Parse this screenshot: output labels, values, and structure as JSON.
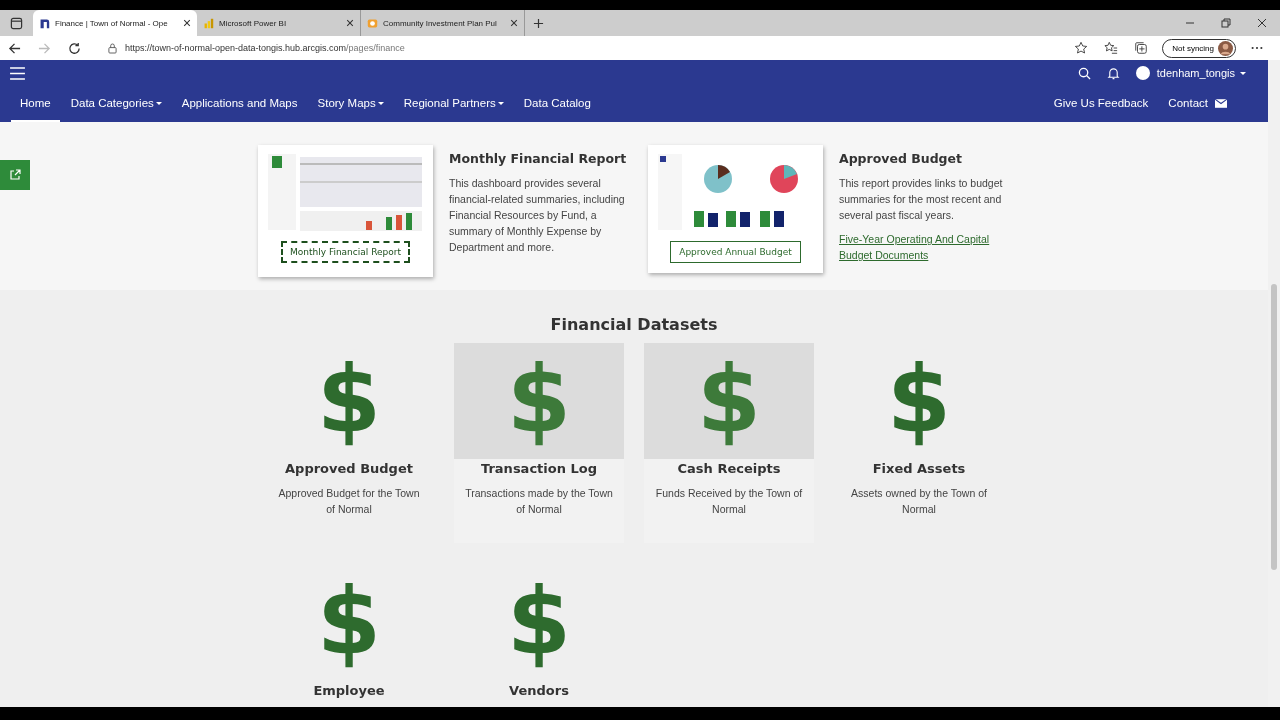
{
  "browser": {
    "tabs": [
      {
        "title": "Finance | Town of Normal - Ope",
        "selected": true
      },
      {
        "title": "Microsoft Power BI",
        "selected": false
      },
      {
        "title": "Community Investment Plan Pul",
        "selected": false
      }
    ],
    "url_host": "https://town-of-normal-open-data-tongis.hub.arcgis.com",
    "url_path": "/pages/finance",
    "sync": "Not syncing"
  },
  "header": {
    "user": "tdenham_tongis",
    "nav": [
      {
        "label": "Home",
        "selected": true,
        "dropdown": false
      },
      {
        "label": "Data Categories",
        "selected": false,
        "dropdown": true
      },
      {
        "label": "Applications and Maps",
        "selected": false,
        "dropdown": false
      },
      {
        "label": "Story Maps",
        "selected": false,
        "dropdown": true
      },
      {
        "label": "Regional Partners",
        "selected": false,
        "dropdown": true
      },
      {
        "label": "Data Catalog",
        "selected": false,
        "dropdown": false
      }
    ],
    "right_links": [
      {
        "label": "Give Us Feedback",
        "kind": "link"
      },
      {
        "label": "Contact",
        "kind": "contact"
      }
    ]
  },
  "featured": [
    {
      "title": "Monthly Financial Report",
      "description": "This dashboard provides several financial-related summaries, including Financial Resources by Fund, a summary of Monthly Expense by Department and more.",
      "button": "Monthly Financial Report",
      "focused": true
    },
    {
      "title": "Approved Budget",
      "description": "This report provides links to budget summaries for the most recent and several past fiscal years.",
      "button": "Approved Annual Budget",
      "focused": false,
      "link": "Five-Year Operating And Capital Budget Documents"
    }
  ],
  "datasets": {
    "title": "Financial Datasets",
    "items": [
      {
        "icon": "$",
        "name": "Approved Budget",
        "description": "Approved Budget for the Town of Normal",
        "highlighted": false
      },
      {
        "icon": "$",
        "name": "Transaction Log",
        "description": "Transactions made by the Town of Normal",
        "highlighted": true
      },
      {
        "icon": "$",
        "name": "Cash Receipts",
        "description": "Funds Received by the Town of Normal",
        "highlighted": true
      },
      {
        "icon": "$",
        "name": "Fixed Assets",
        "description": "Assets owned by the Town of Normal",
        "highlighted": false
      },
      {
        "icon": "$",
        "name": "Employee",
        "highlighted": false
      },
      {
        "icon": "$",
        "name": "Vendors",
        "highlighted": false
      }
    ]
  }
}
